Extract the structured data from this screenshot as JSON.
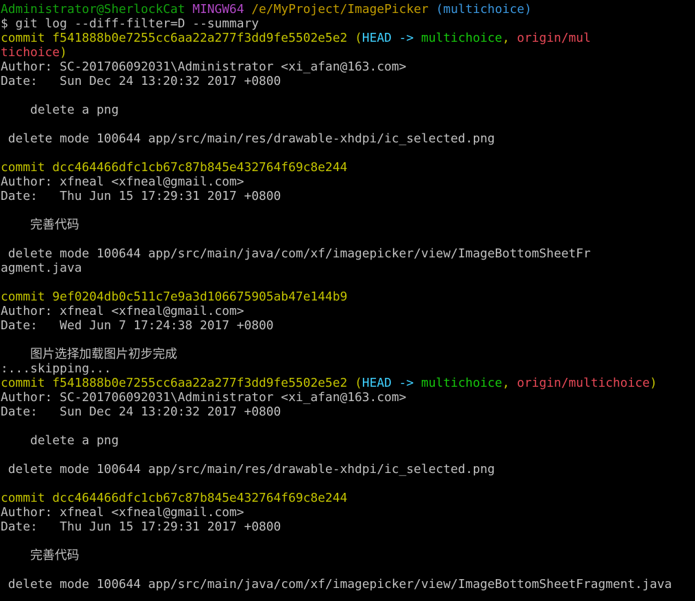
{
  "colors": {
    "background": "#000000",
    "text": "#c0c0c0",
    "prompt_user_host": "#13a10e",
    "prompt_system": "#b148c6",
    "prompt_path": "#c19c00",
    "prompt_branch": "#3a96dd",
    "commit_hash": "#c4c400",
    "head_ref": "#3fd0ff",
    "local_branch": "#16c60c",
    "remote_branch": "#e74856"
  },
  "terminal": {
    "lines": [
      {
        "segments": [
          {
            "text": "Administrator@SherlockCat",
            "color": "#13a10e",
            "role": "prompt-user-host"
          },
          {
            "text": " ",
            "color": "#c0c0c0",
            "role": "text"
          },
          {
            "text": "MINGW64",
            "color": "#b148c6",
            "role": "prompt-system"
          },
          {
            "text": " ",
            "color": "#c0c0c0",
            "role": "text"
          },
          {
            "text": "/e/MyProject/ImagePicker",
            "color": "#c19c00",
            "role": "prompt-path"
          },
          {
            "text": " (multichoice)",
            "color": "#3a96dd",
            "role": "prompt-branch"
          }
        ]
      },
      {
        "segments": [
          {
            "text": "$ git log --diff-filter=D --summary",
            "color": "#c0c0c0",
            "role": "command"
          }
        ]
      },
      {
        "segments": [
          {
            "text": "commit f541888b0e7255cc6aa22a277f3dd9fe5502e5e2 (",
            "color": "#c4c400",
            "role": "commit-hash"
          },
          {
            "text": "HEAD -> ",
            "color": "#3fd0ff",
            "role": "head-ref"
          },
          {
            "text": "multichoice",
            "color": "#16c60c",
            "role": "local-branch"
          },
          {
            "text": ", ",
            "color": "#c4c400",
            "role": "commit-hash"
          },
          {
            "text": "origin/mul",
            "color": "#e74856",
            "role": "remote-branch"
          }
        ]
      },
      {
        "segments": [
          {
            "text": "tichoice",
            "color": "#e74856",
            "role": "remote-branch"
          },
          {
            "text": ")",
            "color": "#c4c400",
            "role": "commit-hash"
          }
        ]
      },
      {
        "segments": [
          {
            "text": "Author: SC-201706092031\\Administrator <xi_afan@163.com>",
            "color": "#c0c0c0",
            "role": "author"
          }
        ]
      },
      {
        "segments": [
          {
            "text": "Date:   Sun Dec 24 13:20:32 2017 +0800",
            "color": "#c0c0c0",
            "role": "date"
          }
        ]
      },
      {
        "segments": []
      },
      {
        "segments": [
          {
            "text": "    delete a png",
            "color": "#c0c0c0",
            "role": "message"
          }
        ]
      },
      {
        "segments": []
      },
      {
        "segments": [
          {
            "text": " delete mode 100644 app/src/main/res/drawable-xhdpi/ic_selected.png",
            "color": "#c0c0c0",
            "role": "summary"
          }
        ]
      },
      {
        "segments": []
      },
      {
        "segments": [
          {
            "text": "commit dcc464466dfc1cb67c87b845e432764f69c8e244",
            "color": "#c4c400",
            "role": "commit-hash"
          }
        ]
      },
      {
        "segments": [
          {
            "text": "Author: xfneal <xfneal@gmail.com>",
            "color": "#c0c0c0",
            "role": "author"
          }
        ]
      },
      {
        "segments": [
          {
            "text": "Date:   Thu Jun 15 17:29:31 2017 +0800",
            "color": "#c0c0c0",
            "role": "date"
          }
        ]
      },
      {
        "segments": []
      },
      {
        "segments": [
          {
            "text": "    ",
            "color": "#c0c0c0",
            "role": "text"
          },
          {
            "text": "完善代码",
            "color": "#c0c0c0",
            "role": "message",
            "cjk": true
          }
        ]
      },
      {
        "segments": []
      },
      {
        "segments": [
          {
            "text": " delete mode 100644 app/src/main/java/com/xf/imagepicker/view/ImageBottomSheetFr",
            "color": "#c0c0c0",
            "role": "summary"
          }
        ]
      },
      {
        "segments": [
          {
            "text": "agment.java",
            "color": "#c0c0c0",
            "role": "summary"
          }
        ]
      },
      {
        "segments": []
      },
      {
        "segments": [
          {
            "text": "commit 9ef0204db0c511c7e9a3d106675905ab47e144b9",
            "color": "#c4c400",
            "role": "commit-hash"
          }
        ]
      },
      {
        "segments": [
          {
            "text": "Author: xfneal <xfneal@gmail.com>",
            "color": "#c0c0c0",
            "role": "author"
          }
        ]
      },
      {
        "segments": [
          {
            "text": "Date:   Wed Jun 7 17:24:38 2017 +0800",
            "color": "#c0c0c0",
            "role": "date"
          }
        ]
      },
      {
        "segments": []
      },
      {
        "segments": [
          {
            "text": "    ",
            "color": "#c0c0c0",
            "role": "text"
          },
          {
            "text": "图片选择加载图片初步完成",
            "color": "#c0c0c0",
            "role": "message",
            "cjk": true
          }
        ]
      },
      {
        "segments": [
          {
            "text": ":...skipping...",
            "color": "#c0c0c0",
            "role": "pager"
          }
        ]
      },
      {
        "segments": [
          {
            "text": "commit f541888b0e7255cc6aa22a277f3dd9fe5502e5e2 (",
            "color": "#c4c400",
            "role": "commit-hash"
          },
          {
            "text": "HEAD -> ",
            "color": "#3fd0ff",
            "role": "head-ref"
          },
          {
            "text": "multichoice",
            "color": "#16c60c",
            "role": "local-branch"
          },
          {
            "text": ", ",
            "color": "#c4c400",
            "role": "commit-hash"
          },
          {
            "text": "origin/multichoice",
            "color": "#e74856",
            "role": "remote-branch"
          },
          {
            "text": ")",
            "color": "#c4c400",
            "role": "commit-hash"
          }
        ]
      },
      {
        "segments": [
          {
            "text": "Author: SC-201706092031\\Administrator <xi_afan@163.com>",
            "color": "#c0c0c0",
            "role": "author"
          }
        ]
      },
      {
        "segments": [
          {
            "text": "Date:   Sun Dec 24 13:20:32 2017 +0800",
            "color": "#c0c0c0",
            "role": "date"
          }
        ]
      },
      {
        "segments": []
      },
      {
        "segments": [
          {
            "text": "    delete a png",
            "color": "#c0c0c0",
            "role": "message"
          }
        ]
      },
      {
        "segments": []
      },
      {
        "segments": [
          {
            "text": " delete mode 100644 app/src/main/res/drawable-xhdpi/ic_selected.png",
            "color": "#c0c0c0",
            "role": "summary"
          }
        ]
      },
      {
        "segments": []
      },
      {
        "segments": [
          {
            "text": "commit dcc464466dfc1cb67c87b845e432764f69c8e244",
            "color": "#c4c400",
            "role": "commit-hash"
          }
        ]
      },
      {
        "segments": [
          {
            "text": "Author: xfneal <xfneal@gmail.com>",
            "color": "#c0c0c0",
            "role": "author"
          }
        ]
      },
      {
        "segments": [
          {
            "text": "Date:   Thu Jun 15 17:29:31 2017 +0800",
            "color": "#c0c0c0",
            "role": "date"
          }
        ]
      },
      {
        "segments": []
      },
      {
        "segments": [
          {
            "text": "    ",
            "color": "#c0c0c0",
            "role": "text"
          },
          {
            "text": "完善代码",
            "color": "#c0c0c0",
            "role": "message",
            "cjk": true
          }
        ]
      },
      {
        "segments": []
      },
      {
        "segments": [
          {
            "text": " delete mode 100644 app/src/main/java/com/xf/imagepicker/view/ImageBottomSheetFragment.java",
            "color": "#c0c0c0",
            "role": "summary"
          }
        ]
      }
    ]
  }
}
